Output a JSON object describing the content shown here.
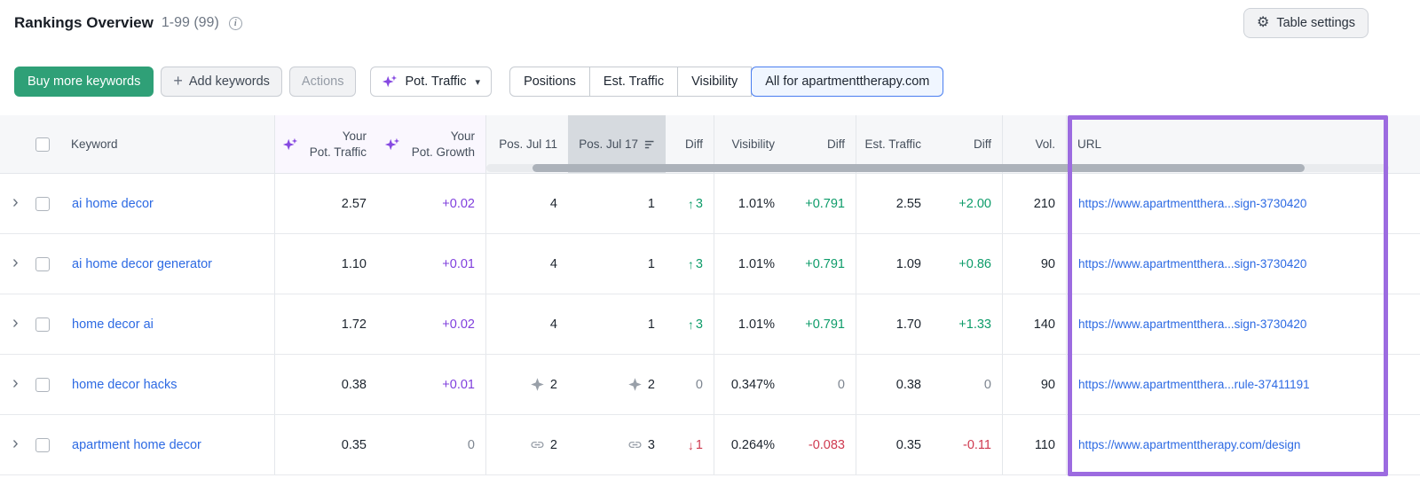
{
  "page": {
    "title": "Rankings Overview",
    "range": "1-99 (99)",
    "table_settings_label": "Table settings"
  },
  "toolbar": {
    "buy_more_keywords": "Buy more keywords",
    "add_keywords": "Add keywords",
    "actions": "Actions",
    "metric_selector": "Pot. Traffic",
    "view_options": [
      "Positions",
      "Est. Traffic",
      "Visibility",
      "All for apartmenttherapy.com"
    ],
    "selected_view": "All for apartmenttherapy.com"
  },
  "table": {
    "columns": {
      "keyword": "Keyword",
      "your_pot_traffic_line1": "Your",
      "your_pot_traffic_line2": "Pot. Traffic",
      "your_pot_growth_line1": "Your",
      "your_pot_growth_line2": "Pot. Growth",
      "pos_jul_11": "Pos. Jul 11",
      "pos_jul_17": "Pos. Jul 17",
      "diff": "Diff",
      "visibility": "Visibility",
      "est_traffic": "Est. Traffic",
      "volume": "Vol.",
      "url": "URL"
    },
    "sorted_column": "Pos. Jul 17",
    "rows": [
      {
        "keyword": "ai home decor",
        "pot_traffic": "2.57",
        "pot_growth": {
          "text": "+0.02",
          "tone": "purple"
        },
        "pos_jul_11": {
          "icon": "none",
          "text": "4"
        },
        "pos_jul_17": {
          "icon": "none",
          "text": "1"
        },
        "pos_diff": {
          "dir": "up",
          "text": "3"
        },
        "visibility": "1.01%",
        "visibility_diff": {
          "tone": "pos",
          "text": "+0.791"
        },
        "est_traffic": "2.55",
        "est_traffic_diff": {
          "tone": "pos",
          "text": "+2.00"
        },
        "volume": "210",
        "url": "https://www.apartmentthera...sign-3730420"
      },
      {
        "keyword": "ai home decor generator",
        "pot_traffic": "1.10",
        "pot_growth": {
          "text": "+0.01",
          "tone": "purple"
        },
        "pos_jul_11": {
          "icon": "none",
          "text": "4"
        },
        "pos_jul_17": {
          "icon": "none",
          "text": "1"
        },
        "pos_diff": {
          "dir": "up",
          "text": "3"
        },
        "visibility": "1.01%",
        "visibility_diff": {
          "tone": "pos",
          "text": "+0.791"
        },
        "est_traffic": "1.09",
        "est_traffic_diff": {
          "tone": "pos",
          "text": "+0.86"
        },
        "volume": "90",
        "url": "https://www.apartmentthera...sign-3730420"
      },
      {
        "keyword": "home decor ai",
        "pot_traffic": "1.72",
        "pot_growth": {
          "text": "+0.02",
          "tone": "purple"
        },
        "pos_jul_11": {
          "icon": "none",
          "text": "4"
        },
        "pos_jul_17": {
          "icon": "none",
          "text": "1"
        },
        "pos_diff": {
          "dir": "up",
          "text": "3"
        },
        "visibility": "1.01%",
        "visibility_diff": {
          "tone": "pos",
          "text": "+0.791"
        },
        "est_traffic": "1.70",
        "est_traffic_diff": {
          "tone": "pos",
          "text": "+1.33"
        },
        "volume": "140",
        "url": "https://www.apartmentthera...sign-3730420"
      },
      {
        "keyword": "home decor hacks",
        "pot_traffic": "0.38",
        "pot_growth": {
          "text": "+0.01",
          "tone": "purple"
        },
        "pos_jul_11": {
          "icon": "serp_feature",
          "text": "2"
        },
        "pos_jul_17": {
          "icon": "serp_feature",
          "text": "2"
        },
        "pos_diff": {
          "dir": "none",
          "text": "0"
        },
        "visibility": "0.347%",
        "visibility_diff": {
          "tone": "gray",
          "text": "0"
        },
        "est_traffic": "0.38",
        "est_traffic_diff": {
          "tone": "gray",
          "text": "0"
        },
        "volume": "90",
        "url": "https://www.apartmentthera...rule-37411191"
      },
      {
        "keyword": "apartment home decor",
        "pot_traffic": "0.35",
        "pot_growth": {
          "text": "0",
          "tone": "gray"
        },
        "pos_jul_11": {
          "icon": "link",
          "text": "2"
        },
        "pos_jul_17": {
          "icon": "link",
          "text": "3"
        },
        "pos_diff": {
          "dir": "down",
          "text": "1"
        },
        "visibility": "0.264%",
        "visibility_diff": {
          "tone": "neg",
          "text": "-0.083"
        },
        "est_traffic": "0.35",
        "est_traffic_diff": {
          "tone": "neg",
          "text": "-0.11"
        },
        "volume": "110",
        "url": "https://www.apartmenttherapy.com/design"
      }
    ]
  },
  "icons": {
    "info": "i",
    "gear": "⚙",
    "plus": "+",
    "chevron_down": "▾",
    "row_expand": "›",
    "arrow_up": "↑",
    "arrow_down": "↓"
  },
  "colors": {
    "positive_green": "#0e9c6a",
    "negative_red": "#cf3a50",
    "ai_purple": "#8649e1",
    "link_blue": "#2d6ae3",
    "buy_button_green": "#2fa077",
    "url_highlight_purple": "#9c6be0",
    "selected_tab_blue": "#4a7ef0"
  }
}
